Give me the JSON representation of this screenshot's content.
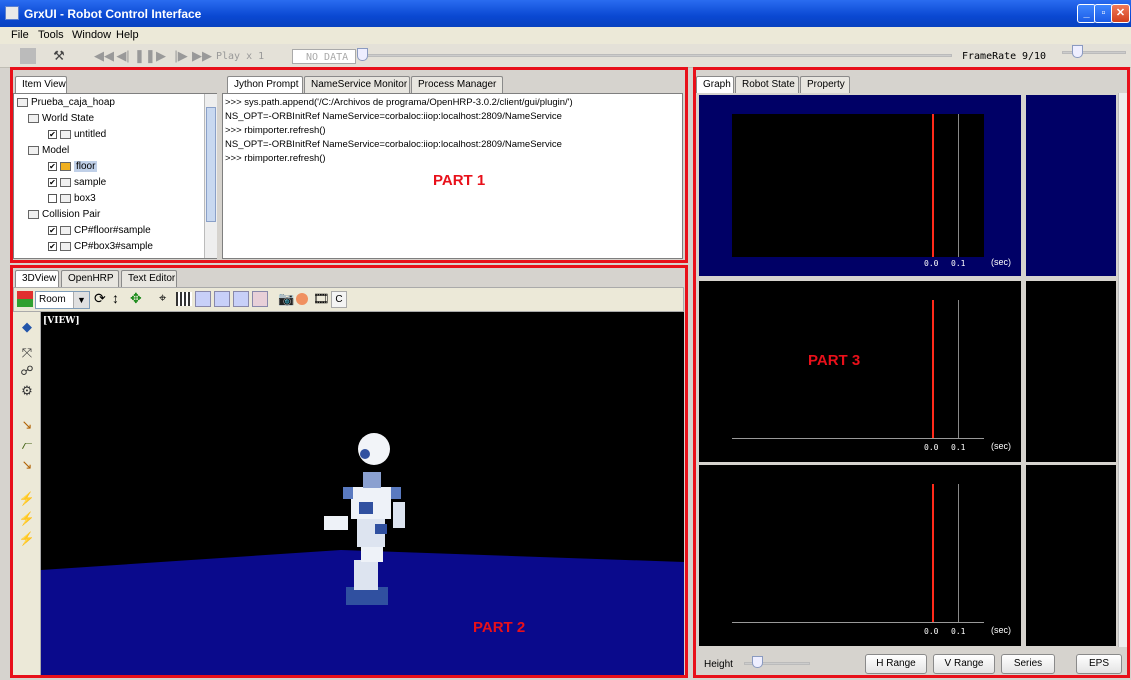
{
  "window": {
    "title": "GrxUI - Robot Control Interface"
  },
  "menu": [
    "File",
    "Tools",
    "Window",
    "Help"
  ],
  "toolbar": {
    "play_label": "Play x 1",
    "data_status": "NO DATA",
    "framerate_label": "FrameRate",
    "framerate_value": "9/10"
  },
  "item_view": {
    "tab": "Item View",
    "tree": [
      {
        "label": "Prueba_caja_hoap",
        "level": 0,
        "check": null
      },
      {
        "label": "World State",
        "level": 1,
        "check": null
      },
      {
        "label": "untitled",
        "level": 2,
        "check": true
      },
      {
        "label": "Model",
        "level": 1,
        "check": null
      },
      {
        "label": "floor",
        "level": 2,
        "check": true,
        "selected": true
      },
      {
        "label": "sample",
        "level": 2,
        "check": true
      },
      {
        "label": "box3",
        "level": 2,
        "check": false
      },
      {
        "label": "Collision Pair",
        "level": 1,
        "check": null
      },
      {
        "label": "CP#floor#sample",
        "level": 2,
        "check": true
      },
      {
        "label": "CP#box3#sample",
        "level": 2,
        "check": true
      }
    ]
  },
  "console": {
    "tabs": [
      "Jython Prompt",
      "NameService Monitor",
      "Process Manager"
    ],
    "lines": [
      ">>> sys.path.append('/C:/Archivos de programa/OpenHRP-3.0.2/client/gui/plugin/')",
      "NS_OPT=-ORBInitRef NameService=corbaloc:iiop:localhost:2809/NameService",
      ">>> rbimporter.refresh()",
      "NS_OPT=-ORBInitRef NameService=corbaloc:iiop:localhost:2809/NameService",
      ">>> rbimporter.refresh()"
    ]
  },
  "view3d": {
    "tabs": [
      "3DView",
      "OpenHRP",
      "Text Editor"
    ],
    "room_select": "Room",
    "view_label": "[VIEW]",
    "c_button": "C"
  },
  "graph": {
    "tabs": [
      "Graph",
      "Robot State",
      "Property"
    ],
    "ticks": [
      "0.0",
      "0.1"
    ],
    "unit": "(sec)",
    "height_label": "Height",
    "buttons": [
      "H Range",
      "V Range",
      "Series",
      "EPS"
    ]
  },
  "annotations": [
    "PART 1",
    "PART 2",
    "PART 3"
  ],
  "colors": {
    "annotation_red": "#e8101a",
    "graph_selected_bg": "#000066",
    "graph_cursor": "#ff2a1a",
    "floor_blue": "#0a0a8c"
  }
}
